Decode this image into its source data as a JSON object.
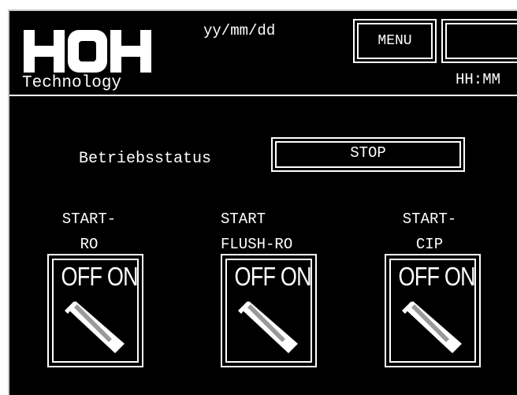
{
  "header": {
    "logo_text": "HOH",
    "logo_subtitle": "Technology",
    "date_format": "yy/mm/dd",
    "time_format": "HH:MM",
    "menu_label": "MENU",
    "blank_button_label": ""
  },
  "status": {
    "label": "Betriebsstatus",
    "value": "STOP"
  },
  "switches": [
    {
      "label": "START-\nRO",
      "state_text": "OFF ON"
    },
    {
      "label": "START\nFLUSH-RO",
      "state_text": "OFF ON"
    },
    {
      "label": "START-\nCIP",
      "state_text": "OFF ON"
    }
  ],
  "colors": {
    "background": "#000000",
    "foreground": "#ffffff",
    "frame": "#c8c8c8"
  }
}
